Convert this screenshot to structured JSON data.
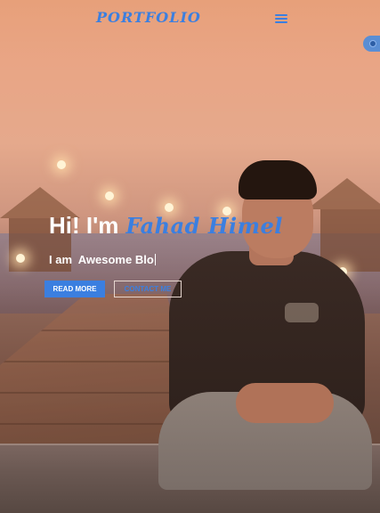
{
  "header": {
    "brand": "PORTFOLIO",
    "menu_icon": "hamburger-menu-icon",
    "settings_icon": "settings-toggle-icon"
  },
  "hero": {
    "greeting_lead": "Hi! I'm",
    "greeting_name": "Fahad Himel",
    "tagline": "I am  Awesome Blo",
    "primary_button": "READ MORE",
    "secondary_button": "CONTACT ME"
  },
  "colors": {
    "accent": "#3b7fe0",
    "text": "#ffffff"
  }
}
